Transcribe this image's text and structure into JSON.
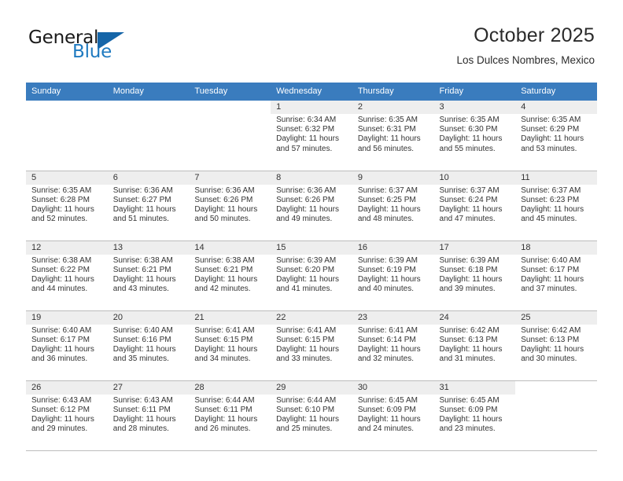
{
  "brand": {
    "name_primary": "General",
    "name_secondary": "Blue",
    "accent_color": "#1f7ac0",
    "triangle_color": "#1565a8"
  },
  "header": {
    "month_title": "October 2025",
    "location": "Los Dulces Nombres, Mexico"
  },
  "calendar": {
    "header_bg": "#3a7cbe",
    "weekday_headers": [
      "Sunday",
      "Monday",
      "Tuesday",
      "Wednesday",
      "Thursday",
      "Friday",
      "Saturday"
    ],
    "weeks": [
      {
        "shaded": true,
        "days": [
          {
            "day": "",
            "sunrise": "",
            "sunset": "",
            "daylight_line1": "",
            "daylight_line2": ""
          },
          {
            "day": "",
            "sunrise": "",
            "sunset": "",
            "daylight_line1": "",
            "daylight_line2": ""
          },
          {
            "day": "",
            "sunrise": "",
            "sunset": "",
            "daylight_line1": "",
            "daylight_line2": ""
          },
          {
            "day": "1",
            "sunrise": "Sunrise: 6:34 AM",
            "sunset": "Sunset: 6:32 PM",
            "daylight_line1": "Daylight: 11 hours",
            "daylight_line2": "and 57 minutes."
          },
          {
            "day": "2",
            "sunrise": "Sunrise: 6:35 AM",
            "sunset": "Sunset: 6:31 PM",
            "daylight_line1": "Daylight: 11 hours",
            "daylight_line2": "and 56 minutes."
          },
          {
            "day": "3",
            "sunrise": "Sunrise: 6:35 AM",
            "sunset": "Sunset: 6:30 PM",
            "daylight_line1": "Daylight: 11 hours",
            "daylight_line2": "and 55 minutes."
          },
          {
            "day": "4",
            "sunrise": "Sunrise: 6:35 AM",
            "sunset": "Sunset: 6:29 PM",
            "daylight_line1": "Daylight: 11 hours",
            "daylight_line2": "and 53 minutes."
          }
        ]
      },
      {
        "shaded": true,
        "days": [
          {
            "day": "5",
            "sunrise": "Sunrise: 6:35 AM",
            "sunset": "Sunset: 6:28 PM",
            "daylight_line1": "Daylight: 11 hours",
            "daylight_line2": "and 52 minutes."
          },
          {
            "day": "6",
            "sunrise": "Sunrise: 6:36 AM",
            "sunset": "Sunset: 6:27 PM",
            "daylight_line1": "Daylight: 11 hours",
            "daylight_line2": "and 51 minutes."
          },
          {
            "day": "7",
            "sunrise": "Sunrise: 6:36 AM",
            "sunset": "Sunset: 6:26 PM",
            "daylight_line1": "Daylight: 11 hours",
            "daylight_line2": "and 50 minutes."
          },
          {
            "day": "8",
            "sunrise": "Sunrise: 6:36 AM",
            "sunset": "Sunset: 6:26 PM",
            "daylight_line1": "Daylight: 11 hours",
            "daylight_line2": "and 49 minutes."
          },
          {
            "day": "9",
            "sunrise": "Sunrise: 6:37 AM",
            "sunset": "Sunset: 6:25 PM",
            "daylight_line1": "Daylight: 11 hours",
            "daylight_line2": "and 48 minutes."
          },
          {
            "day": "10",
            "sunrise": "Sunrise: 6:37 AM",
            "sunset": "Sunset: 6:24 PM",
            "daylight_line1": "Daylight: 11 hours",
            "daylight_line2": "and 47 minutes."
          },
          {
            "day": "11",
            "sunrise": "Sunrise: 6:37 AM",
            "sunset": "Sunset: 6:23 PM",
            "daylight_line1": "Daylight: 11 hours",
            "daylight_line2": "and 45 minutes."
          }
        ]
      },
      {
        "shaded": true,
        "days": [
          {
            "day": "12",
            "sunrise": "Sunrise: 6:38 AM",
            "sunset": "Sunset: 6:22 PM",
            "daylight_line1": "Daylight: 11 hours",
            "daylight_line2": "and 44 minutes."
          },
          {
            "day": "13",
            "sunrise": "Sunrise: 6:38 AM",
            "sunset": "Sunset: 6:21 PM",
            "daylight_line1": "Daylight: 11 hours",
            "daylight_line2": "and 43 minutes."
          },
          {
            "day": "14",
            "sunrise": "Sunrise: 6:38 AM",
            "sunset": "Sunset: 6:21 PM",
            "daylight_line1": "Daylight: 11 hours",
            "daylight_line2": "and 42 minutes."
          },
          {
            "day": "15",
            "sunrise": "Sunrise: 6:39 AM",
            "sunset": "Sunset: 6:20 PM",
            "daylight_line1": "Daylight: 11 hours",
            "daylight_line2": "and 41 minutes."
          },
          {
            "day": "16",
            "sunrise": "Sunrise: 6:39 AM",
            "sunset": "Sunset: 6:19 PM",
            "daylight_line1": "Daylight: 11 hours",
            "daylight_line2": "and 40 minutes."
          },
          {
            "day": "17",
            "sunrise": "Sunrise: 6:39 AM",
            "sunset": "Sunset: 6:18 PM",
            "daylight_line1": "Daylight: 11 hours",
            "daylight_line2": "and 39 minutes."
          },
          {
            "day": "18",
            "sunrise": "Sunrise: 6:40 AM",
            "sunset": "Sunset: 6:17 PM",
            "daylight_line1": "Daylight: 11 hours",
            "daylight_line2": "and 37 minutes."
          }
        ]
      },
      {
        "shaded": true,
        "days": [
          {
            "day": "19",
            "sunrise": "Sunrise: 6:40 AM",
            "sunset": "Sunset: 6:17 PM",
            "daylight_line1": "Daylight: 11 hours",
            "daylight_line2": "and 36 minutes."
          },
          {
            "day": "20",
            "sunrise": "Sunrise: 6:40 AM",
            "sunset": "Sunset: 6:16 PM",
            "daylight_line1": "Daylight: 11 hours",
            "daylight_line2": "and 35 minutes."
          },
          {
            "day": "21",
            "sunrise": "Sunrise: 6:41 AM",
            "sunset": "Sunset: 6:15 PM",
            "daylight_line1": "Daylight: 11 hours",
            "daylight_line2": "and 34 minutes."
          },
          {
            "day": "22",
            "sunrise": "Sunrise: 6:41 AM",
            "sunset": "Sunset: 6:15 PM",
            "daylight_line1": "Daylight: 11 hours",
            "daylight_line2": "and 33 minutes."
          },
          {
            "day": "23",
            "sunrise": "Sunrise: 6:41 AM",
            "sunset": "Sunset: 6:14 PM",
            "daylight_line1": "Daylight: 11 hours",
            "daylight_line2": "and 32 minutes."
          },
          {
            "day": "24",
            "sunrise": "Sunrise: 6:42 AM",
            "sunset": "Sunset: 6:13 PM",
            "daylight_line1": "Daylight: 11 hours",
            "daylight_line2": "and 31 minutes."
          },
          {
            "day": "25",
            "sunrise": "Sunrise: 6:42 AM",
            "sunset": "Sunset: 6:13 PM",
            "daylight_line1": "Daylight: 11 hours",
            "daylight_line2": "and 30 minutes."
          }
        ]
      },
      {
        "shaded": true,
        "days": [
          {
            "day": "26",
            "sunrise": "Sunrise: 6:43 AM",
            "sunset": "Sunset: 6:12 PM",
            "daylight_line1": "Daylight: 11 hours",
            "daylight_line2": "and 29 minutes."
          },
          {
            "day": "27",
            "sunrise": "Sunrise: 6:43 AM",
            "sunset": "Sunset: 6:11 PM",
            "daylight_line1": "Daylight: 11 hours",
            "daylight_line2": "and 28 minutes."
          },
          {
            "day": "28",
            "sunrise": "Sunrise: 6:44 AM",
            "sunset": "Sunset: 6:11 PM",
            "daylight_line1": "Daylight: 11 hours",
            "daylight_line2": "and 26 minutes."
          },
          {
            "day": "29",
            "sunrise": "Sunrise: 6:44 AM",
            "sunset": "Sunset: 6:10 PM",
            "daylight_line1": "Daylight: 11 hours",
            "daylight_line2": "and 25 minutes."
          },
          {
            "day": "30",
            "sunrise": "Sunrise: 6:45 AM",
            "sunset": "Sunset: 6:09 PM",
            "daylight_line1": "Daylight: 11 hours",
            "daylight_line2": "and 24 minutes."
          },
          {
            "day": "31",
            "sunrise": "Sunrise: 6:45 AM",
            "sunset": "Sunset: 6:09 PM",
            "daylight_line1": "Daylight: 11 hours",
            "daylight_line2": "and 23 minutes."
          },
          {
            "day": "",
            "sunrise": "",
            "sunset": "",
            "daylight_line1": "",
            "daylight_line2": ""
          }
        ]
      }
    ]
  }
}
